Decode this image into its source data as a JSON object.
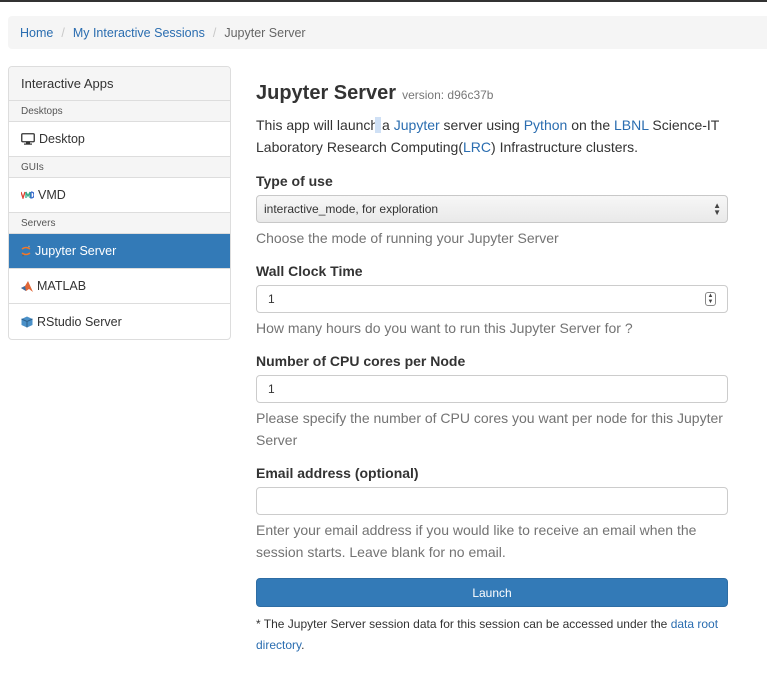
{
  "breadcrumb": {
    "home": "Home",
    "sessions": "My Interactive Sessions",
    "current": "Jupyter Server"
  },
  "sidebar": {
    "header": "Interactive Apps",
    "groups": {
      "desktops": "Desktops",
      "guis": "GUIs",
      "servers": "Servers"
    },
    "items": {
      "desktop": "Desktop",
      "vmd": "VMD",
      "jupyter": "Jupyter Server",
      "matlab": "MATLAB",
      "rstudio": "RStudio Server"
    },
    "active_color": "#337ab7"
  },
  "app": {
    "title": "Jupyter Server",
    "version": "version: d96c37b",
    "desc": {
      "t1": "This app will launch",
      "t2": " a ",
      "jupyter": "Jupyter",
      "t3": " server using ",
      "python": "Python",
      "t4": " on the ",
      "lbnl": "LBNL",
      "t5": " Science-IT Laboratory Research Computing(",
      "lrc": "LRC",
      "t6": ") Infrastructure clusters."
    }
  },
  "form": {
    "type_of_use": {
      "label": "Type of use",
      "value": "interactive_mode, for exploration",
      "help": "Choose the mode of running your Jupyter Server"
    },
    "wall_clock": {
      "label": "Wall Clock Time",
      "value": "1",
      "help": "How many hours do you want to run this Jupyter Server for ?"
    },
    "cpu_cores": {
      "label": "Number of CPU cores per Node",
      "value": "1",
      "help": "Please specify the number of CPU cores you want per node for this Jupyter Server"
    },
    "email": {
      "label": "Email address (optional)",
      "value": "",
      "help": "Enter your email address if you would like to receive an email when the session starts. Leave blank for no email."
    },
    "launch_label": "Launch"
  },
  "footnote": {
    "text": "* The Jupyter Server session data for this session can be accessed under the ",
    "link": "data root directory",
    "end": "."
  },
  "icons": {
    "desktop": "monitor-icon",
    "vmd": "vmd-logo-icon",
    "jupyter": "jupyter-logo-icon",
    "matlab": "matlab-logo-icon",
    "rstudio": "rstudio-logo-icon"
  }
}
